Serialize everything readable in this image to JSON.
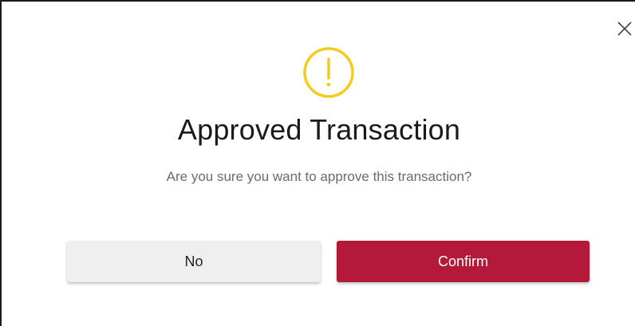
{
  "dialog": {
    "title": "Approved Transaction",
    "message": "Are you sure you want to approve this transaction?",
    "icon": "warning-circle-icon",
    "icon_color": "#f2cc1e",
    "close_icon": "close-icon"
  },
  "actions": {
    "no_label": "No",
    "confirm_label": "Confirm",
    "confirm_color": "#b5193a",
    "no_color": "#efefef"
  }
}
